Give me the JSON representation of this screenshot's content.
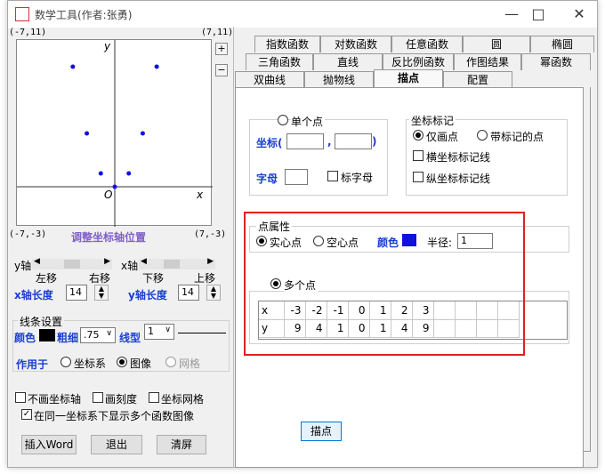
{
  "window": {
    "title": "数学工具(作者:张勇)",
    "controls": {
      "minimize": "—",
      "maximize": "□",
      "close": "✕"
    }
  },
  "graph": {
    "corner_tl": "(-7,11)",
    "corner_tr": "(7,11)",
    "corner_bl": "(-7,-3)",
    "corner_br": "(7,-3)",
    "axis_x": "x",
    "axis_y": "y",
    "origin": "O",
    "zoom_in": "+",
    "zoom_out": "−",
    "adjust_label": "调整坐标轴位置",
    "points": [
      [
        -3,
        9
      ],
      [
        -2,
        4
      ],
      [
        -1,
        1
      ],
      [
        0,
        0
      ],
      [
        1,
        1
      ],
      [
        2,
        4
      ],
      [
        3,
        9
      ]
    ],
    "xlim": [
      -7,
      7
    ],
    "ylim": [
      -3,
      11
    ]
  },
  "axis_controls": {
    "y_axis": "y轴",
    "x_axis": "x轴",
    "y_left": "左移",
    "y_right": "右移",
    "x_down": "下移",
    "x_up": "上移",
    "x_len_label": "x轴长度",
    "x_len_value": "14",
    "y_len_label": "y轴长度",
    "y_len_value": "14"
  },
  "line_settings": {
    "group": "线条设置",
    "color_label": "颜色",
    "width_label": "粗细",
    "width_value": ".75",
    "style_label": "线型",
    "style_value": "1",
    "apply_label": "作用于",
    "opt_axes": "坐标系",
    "opt_image": "图像",
    "opt_grid": "网格"
  },
  "options": {
    "no_axis": "不画坐标轴",
    "tick": "画刻度",
    "grid": "坐标网格",
    "multi": "在同一坐标系下显示多个函数图像"
  },
  "bottom_buttons": {
    "insert_word": "插入Word",
    "exit": "退出",
    "clear": "清屏"
  },
  "tabs": {
    "row1": [
      "指数函数",
      "对数函数",
      "任意函数",
      "圆",
      "椭圆"
    ],
    "row2": [
      "三角函数",
      "直线",
      "反比例函数",
      "作图结果",
      "幂函数"
    ],
    "row3": [
      "双曲线",
      "抛物线",
      "描点",
      "配置"
    ]
  },
  "single_point": {
    "title": "单个点",
    "coord_label": "坐标(",
    "comma": ",",
    "close_paren": ")",
    "letter_label": "字母",
    "mark_letter": "标字母"
  },
  "mark": {
    "title": "坐标标记",
    "only_dot": "仅画点",
    "with_mark": "带标记的点",
    "h_line": "横坐标标记线",
    "v_line": "纵坐标标记线"
  },
  "point_attr": {
    "title": "点属性",
    "solid": "实心点",
    "hollow": "空心点",
    "color_label": "颜色",
    "radius_label": "半径:",
    "radius_value": "1"
  },
  "multi_point": {
    "title": "多个点",
    "x_row": [
      "x",
      "-3",
      "-2",
      "-1",
      "0",
      "1",
      "2",
      "3",
      "",
      "",
      "",
      ""
    ],
    "y_row": [
      "y",
      "9",
      "4",
      "1",
      "0",
      "1",
      "4",
      "9",
      "",
      "",
      "",
      ""
    ]
  },
  "plot_button": "描点",
  "colors": {
    "accent_blue": "#1a3fd0",
    "point_color": "#1010e0",
    "highlight_red": "#e02020"
  }
}
